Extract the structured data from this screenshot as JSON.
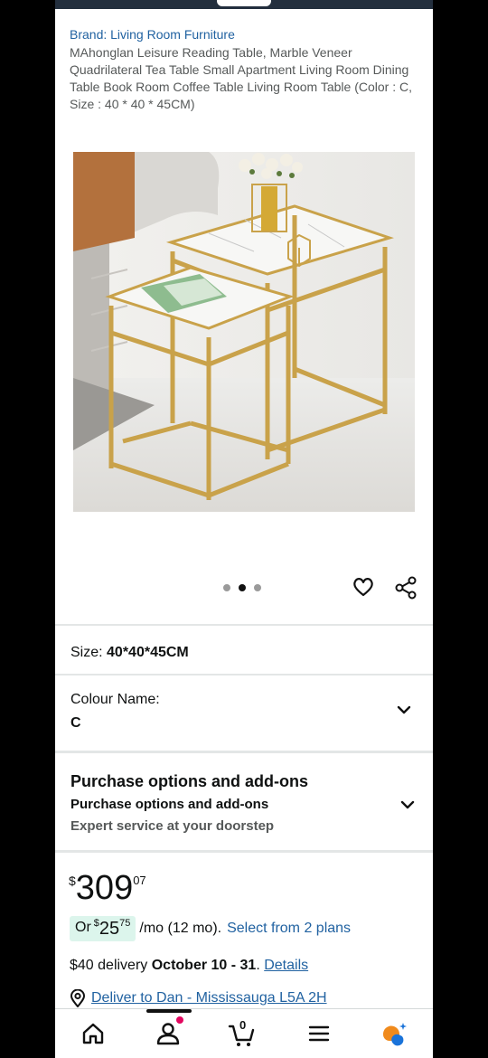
{
  "product": {
    "brand": "Brand: Living Room Furniture",
    "title": "MAhonglan Leisure Reading Table, Marble Veneer Quadrilateral Tea Table Small Apartment Living Room Dining Table Book Room Coffee Table Living Room Table (Color : C, Size : 40 * 40 * 45CM)"
  },
  "gallery": {
    "image_alt": "Nesting side tables with white marble tops and gold frames",
    "dot_count": 3,
    "active_dot": 1
  },
  "size": {
    "label": "Size:",
    "value": "40*40*45CM"
  },
  "colour": {
    "label": "Colour Name:",
    "value": "C"
  },
  "purchase_options": {
    "title": "Purchase options and add-ons",
    "subtitle": "Purchase options and add-ons",
    "description": "Expert service at your doorstep"
  },
  "price": {
    "symbol": "$",
    "whole": "309",
    "fraction": "07"
  },
  "installment": {
    "prefix": "Or ",
    "symbol": "$",
    "whole": "25",
    "fraction": "75",
    "term": "/mo (12 mo).",
    "plans_link": "Select from 2 plans"
  },
  "delivery": {
    "prefix": "$40 delivery ",
    "dates": "October 10 - 31",
    "separator": ". ",
    "details_link": "Details"
  },
  "deliver_to": {
    "text": "Deliver to Dan - Mississauga L5A 2H"
  },
  "nav": {
    "cart_count": "0"
  },
  "colors": {
    "link": "#2162a1",
    "header": "#232f3e",
    "install_bg": "#dcf5ec",
    "badge": "#e3075f",
    "gold": "#c9a24a"
  }
}
